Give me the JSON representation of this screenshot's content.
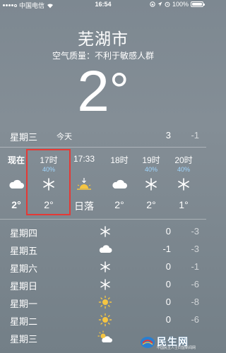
{
  "status_bar": {
    "carrier": "中国电信",
    "time": "16:54",
    "battery": "100%",
    "icons": [
      "signal-icon",
      "wifi-icon",
      "lock-rotation-icon",
      "location-icon",
      "alarm-icon",
      "battery-icon"
    ]
  },
  "location": {
    "city": "芜湖市",
    "air_quality": "空气质量：不利于敏感人群",
    "current_temp": "2",
    "degree": "°"
  },
  "today": {
    "day": "星期三",
    "tag": "今天",
    "high": "3",
    "low": "-1"
  },
  "hourly": [
    {
      "label": "现在",
      "pct": "",
      "icon": "cloud-icon",
      "temp": "2°",
      "bold": true
    },
    {
      "label": "17时",
      "pct": "40%",
      "icon": "snow-icon",
      "temp": "2°",
      "bold": false
    },
    {
      "label": "17:33",
      "pct": "",
      "icon": "sunset-icon",
      "temp": "日落",
      "bold": false
    },
    {
      "label": "18时",
      "pct": "",
      "icon": "cloud-icon",
      "temp": "2°",
      "bold": false
    },
    {
      "label": "19时",
      "pct": "40%",
      "icon": "snow-icon",
      "temp": "2°",
      "bold": false
    },
    {
      "label": "20时",
      "pct": "40%",
      "icon": "snow-icon",
      "temp": "1°",
      "bold": false
    }
  ],
  "daily": [
    {
      "name": "星期四",
      "icon": "snow-icon",
      "high": "0",
      "low": "-3"
    },
    {
      "name": "星期五",
      "icon": "cloud-icon",
      "high": "-1",
      "low": "-3"
    },
    {
      "name": "星期六",
      "icon": "snow-icon",
      "high": "0",
      "low": "-1"
    },
    {
      "name": "星期日",
      "icon": "snow-icon",
      "high": "0",
      "low": "-6"
    },
    {
      "name": "星期一",
      "icon": "sun-icon",
      "high": "0",
      "low": "-8"
    },
    {
      "name": "星期二",
      "icon": "sun-icon",
      "high": "0",
      "low": "-6"
    },
    {
      "name": "星期三",
      "icon": "partly-cloudy-icon",
      "high": "",
      "low": ""
    }
  ],
  "watermark": {
    "text": "民生网",
    "subtext": "中国民主人士同盟新闻网"
  },
  "colors": {
    "precip": "#9fd6ff",
    "highlight": "#e53935",
    "sun": "#f5c542"
  }
}
